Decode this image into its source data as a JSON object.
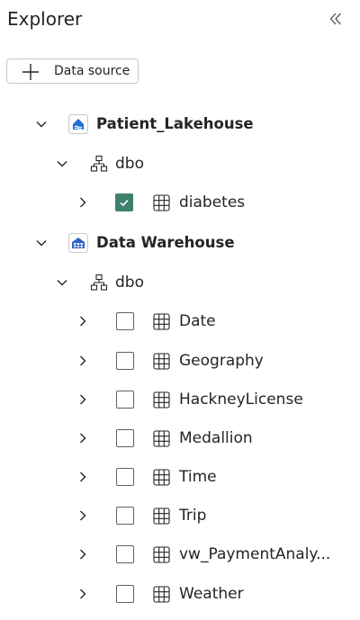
{
  "header": {
    "title": "Explorer",
    "collapse_icon": "double-chevron-left-icon"
  },
  "toolbar": {
    "add_label": "Data source",
    "add_icon": "plus-icon"
  },
  "tree": {
    "databases": [
      {
        "name": "Patient_Lakehouse",
        "icon": "lakehouse-icon",
        "expanded": true,
        "schemas": [
          {
            "name": "dbo",
            "expanded": true,
            "tables": [
              {
                "name": "diabetes",
                "checked": true
              }
            ]
          }
        ]
      },
      {
        "name": "Data Warehouse",
        "icon": "warehouse-icon",
        "expanded": true,
        "schemas": [
          {
            "name": "dbo",
            "expanded": true,
            "tables": [
              {
                "name": "Date",
                "checked": false
              },
              {
                "name": "Geography",
                "checked": false
              },
              {
                "name": "HackneyLicense",
                "checked": false
              },
              {
                "name": "Medallion",
                "checked": false
              },
              {
                "name": "Time",
                "checked": false
              },
              {
                "name": "Trip",
                "checked": false
              },
              {
                "name": "vw_PaymentAnaly...",
                "checked": false
              },
              {
                "name": "Weather",
                "checked": false
              }
            ]
          }
        ]
      }
    ]
  },
  "colors": {
    "checkbox_checked": "#3f7f6e",
    "lakehouse_icon": "#1f6fd6",
    "warehouse_icon": "#2f63c8"
  }
}
